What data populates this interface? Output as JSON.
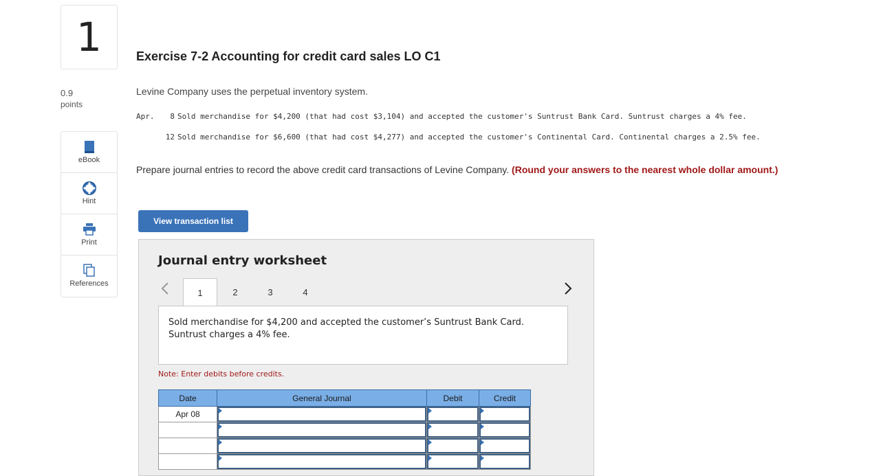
{
  "question": {
    "number": "1",
    "points_value": "0.9",
    "points_label": "points"
  },
  "tools": [
    {
      "label": "eBook",
      "icon": "book-icon"
    },
    {
      "label": "Hint",
      "icon": "lifebuoy-icon"
    },
    {
      "label": "Print",
      "icon": "printer-icon"
    },
    {
      "label": "References",
      "icon": "copy-icon"
    }
  ],
  "title": "Exercise 7-2 Accounting for credit card sales LO C1",
  "intro": "Levine Company uses the perpetual inventory system.",
  "transactions": {
    "month": "Apr.",
    "items": [
      {
        "day": "8",
        "text": "Sold merchandise for $4,200 (that had cost $3,104) and accepted the customer's Suntrust Bank Card. Suntrust charges a 4% fee."
      },
      {
        "day": "12",
        "text": "Sold merchandise for $6,600 (that had cost $4,277) and accepted the customer's Continental Card. Continental charges a 2.5% fee."
      }
    ]
  },
  "prepare": {
    "text": "Prepare journal entries to record the above credit card transactions of Levine Company.",
    "emphasis": "(Round your answers to the nearest whole dollar amount.)"
  },
  "view_button": "View transaction list",
  "worksheet": {
    "title": "Journal entry worksheet",
    "tabs": [
      "1",
      "2",
      "3",
      "4"
    ],
    "description": "Sold merchandise for $4,200 and accepted the customer’s Suntrust Bank Card. Suntrust charges a 4% fee.",
    "note": "Note: Enter debits before credits.",
    "columns": [
      "Date",
      "General Journal",
      "Debit",
      "Credit"
    ],
    "rows": [
      {
        "date": "Apr 08"
      },
      {
        "date": ""
      },
      {
        "date": ""
      },
      {
        "date": ""
      }
    ]
  },
  "colors": {
    "accent": "#3a73b8",
    "header_blue": "#7aaee6",
    "emphasis_red": "#a01818"
  }
}
